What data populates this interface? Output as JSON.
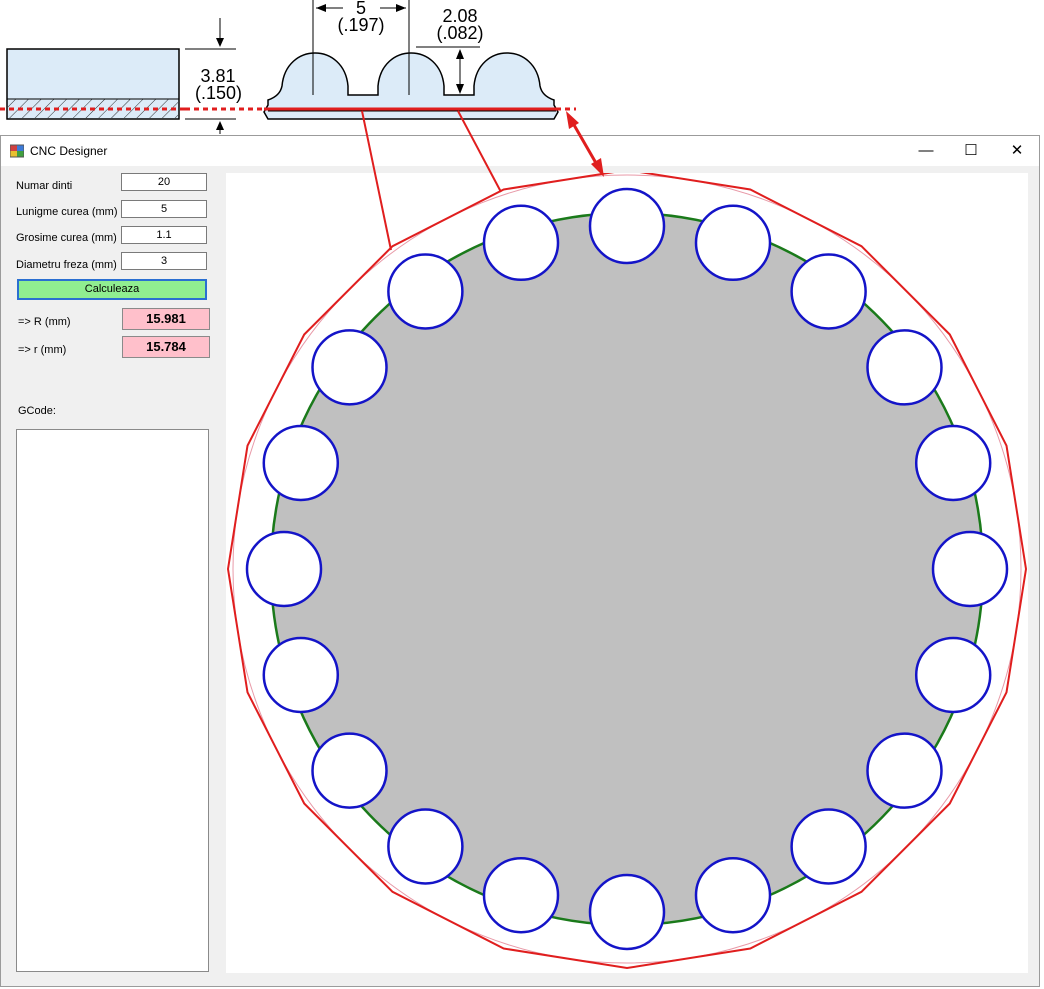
{
  "window": {
    "title": "CNC Designer"
  },
  "controls": {
    "teeth_label": "Numar dinti",
    "teeth_value": "20",
    "length_label": "Lunigme curea (mm)",
    "length_value": "5",
    "thickness_label": "Grosime curea (mm)",
    "thickness_value": "1.1",
    "cutter_label": "Diametru freza (mm)",
    "cutter_value": "3",
    "calc_label": "Calculeaza",
    "R_label": "=> R (mm)",
    "R_value": "15.981",
    "r_label": "=> r (mm)",
    "r_value": "15.784",
    "gcode_label": "GCode:",
    "gcode_text": ""
  },
  "belt_diagram": {
    "height_top": "3.81",
    "height_bottom": "(.150)",
    "pitch_top": "5",
    "pitch_bottom": "(.197)",
    "tooth_top": "2.08",
    "tooth_bottom": "(.082)"
  },
  "icons": {
    "app": "app-icon",
    "minimize": "minimize-icon",
    "maximize": "maximize-icon",
    "close": "close-icon"
  },
  "colors": {
    "gear_fill": "#c0c0c0",
    "tooth_outline": "#1a7a1a",
    "cutter_circle": "#1414c8",
    "outer_polygon": "#e01e1e",
    "calc_button": "#90ee90",
    "result_box": "#ffc0cb"
  }
}
